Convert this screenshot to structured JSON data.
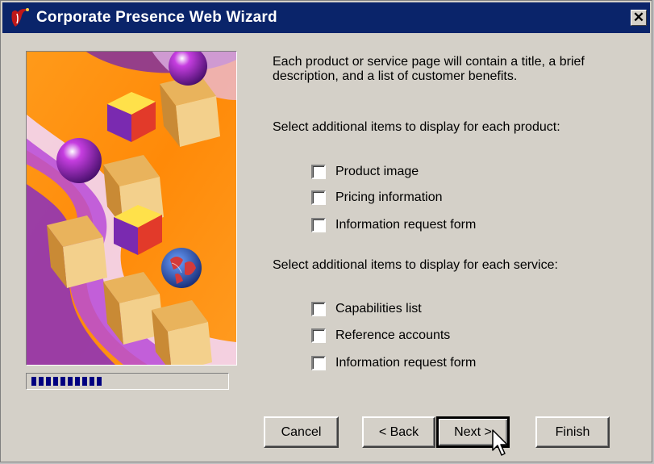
{
  "window": {
    "title": "Corporate Presence Web Wizard",
    "close_glyph": "✕",
    "accent": "#0a246a"
  },
  "intro": {
    "line1": "Each product or service page will contain a title, a brief",
    "line2": "description, and a list of customer benefits."
  },
  "product": {
    "heading": "Select additional items to display for each product:",
    "options": [
      {
        "label": "Product image",
        "checked": false
      },
      {
        "label": "Pricing information",
        "checked": false
      },
      {
        "label": "Information request form",
        "checked": false
      }
    ]
  },
  "service": {
    "heading": "Select additional items to display for each service:",
    "options": [
      {
        "label": "Capabilities list",
        "checked": false
      },
      {
        "label": "Reference accounts",
        "checked": false
      },
      {
        "label": "Information request form",
        "checked": false
      }
    ]
  },
  "progress": {
    "fraction": 0.4
  },
  "buttons": {
    "cancel": "Cancel",
    "back": "< Back",
    "next": "Next >",
    "finish": "Finish"
  }
}
